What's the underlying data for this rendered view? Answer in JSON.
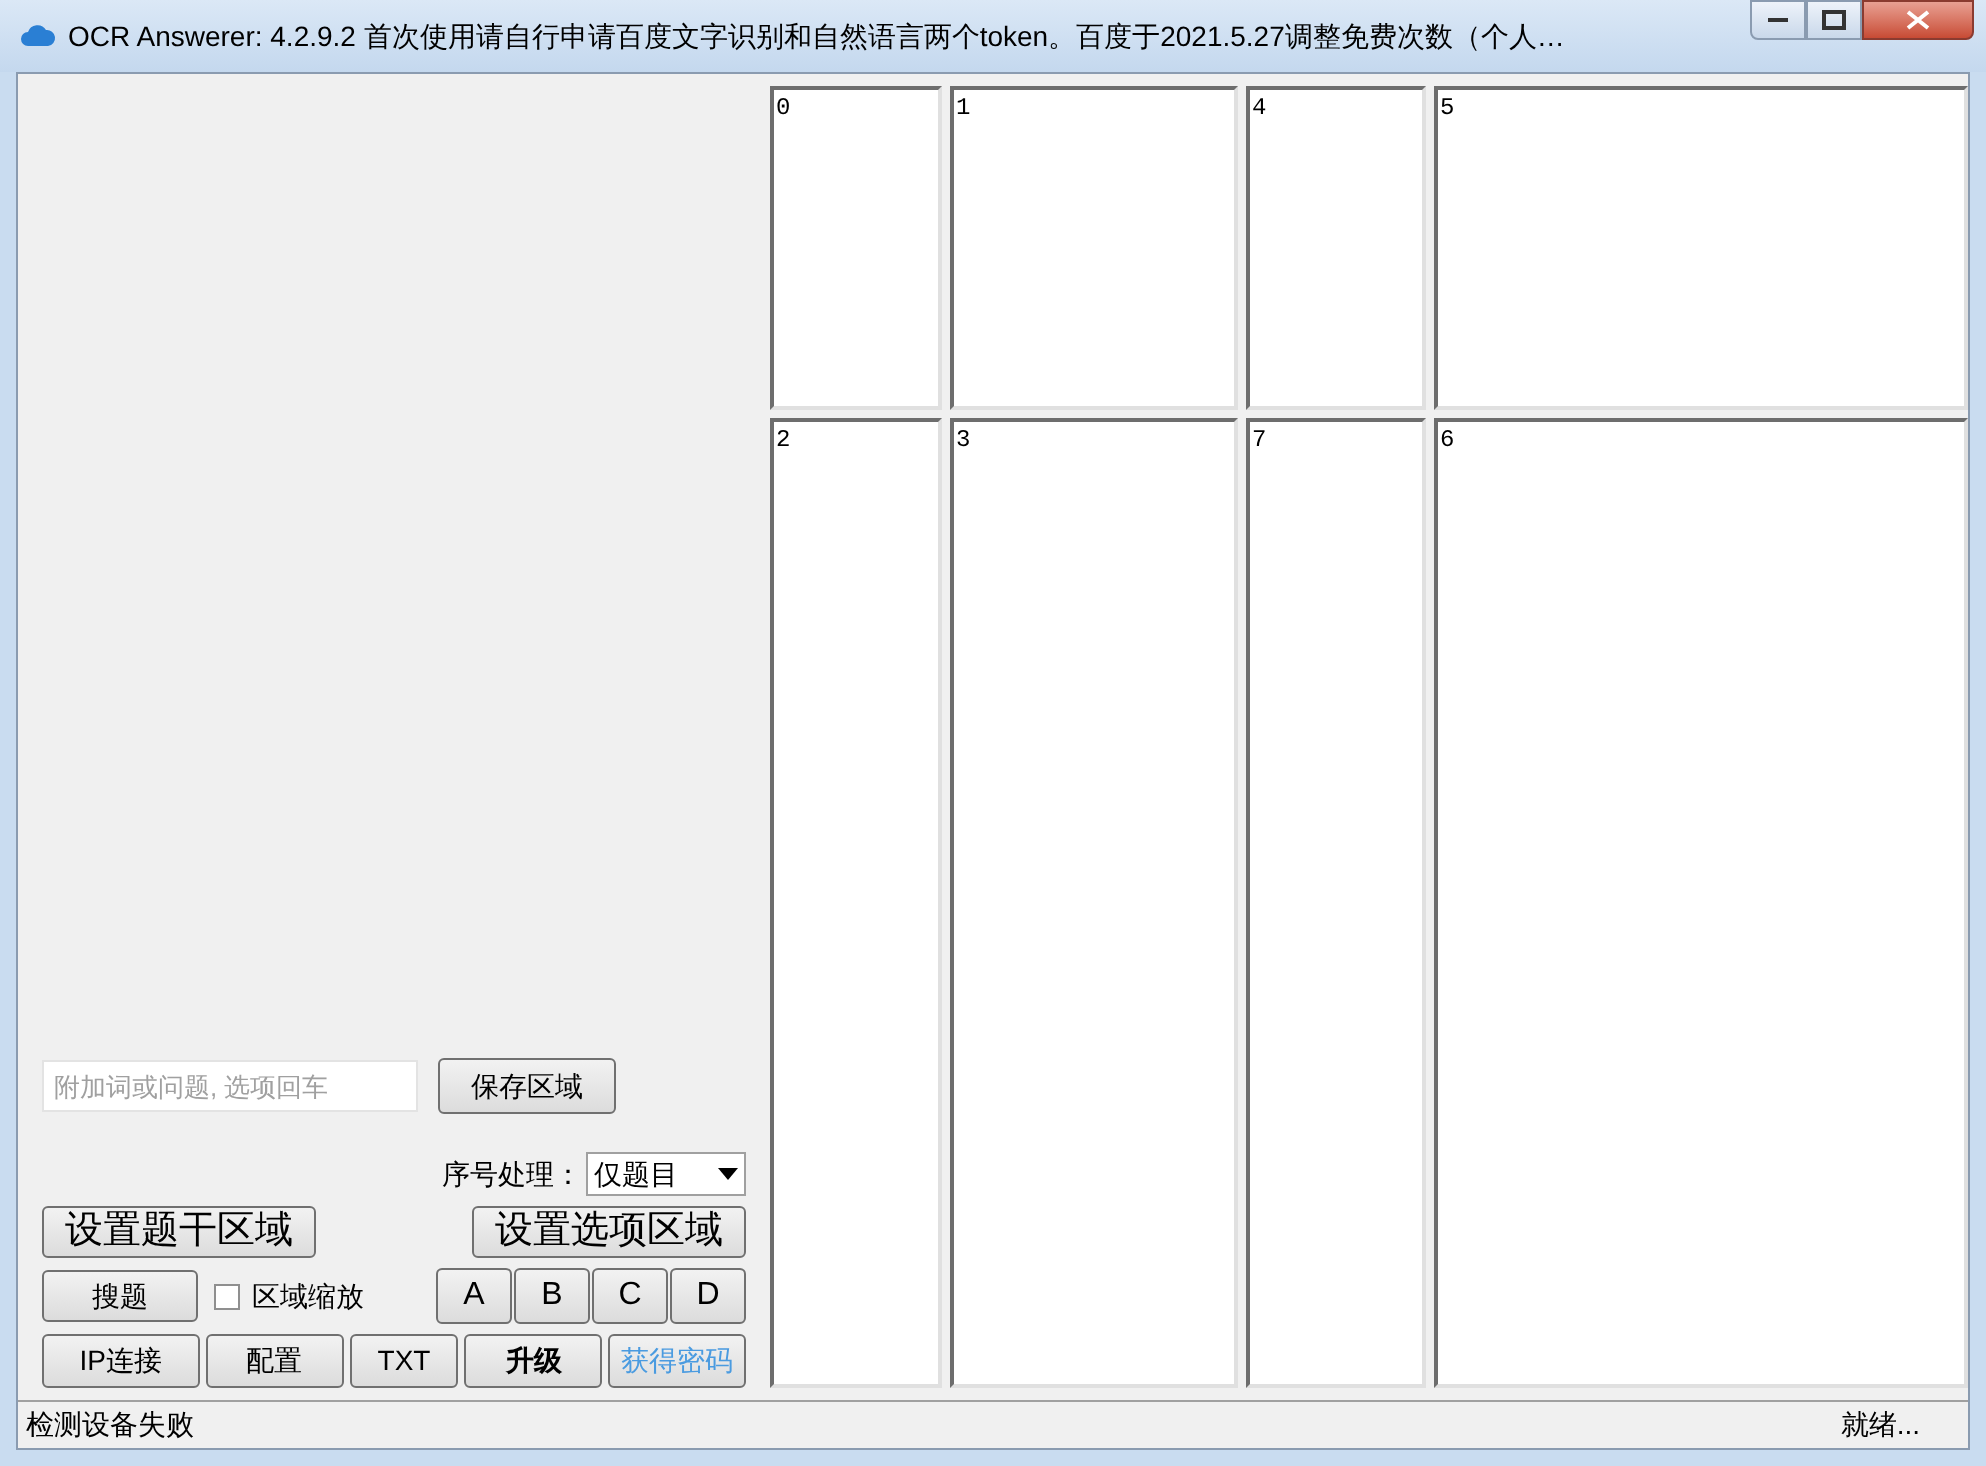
{
  "window": {
    "title": "OCR Answerer: 4.2.9.2 首次使用请自行申请百度文字识别和自然语言两个token。百度于2021.5.27调整免费次数（个人…"
  },
  "panes": [
    [
      "0",
      "1",
      "4",
      "5"
    ],
    [
      "2",
      "3",
      "7",
      "6"
    ]
  ],
  "input": {
    "placeholder": "附加词或问题, 选项回车"
  },
  "save_button": "保存区域",
  "numbering": {
    "label": "序号处理：",
    "value": "仅题目"
  },
  "set_stem_button": "设置题干区域",
  "set_options_button": "设置选项区域",
  "search_button": "搜题",
  "zoom_checkbox": {
    "label": "区域缩放",
    "checked": false
  },
  "option_buttons": [
    "A",
    "B",
    "C",
    "D"
  ],
  "bottom_buttons": [
    {
      "label": "IP连接",
      "kind": "normal"
    },
    {
      "label": "配置",
      "kind": "normal"
    },
    {
      "label": "TXT",
      "kind": "normal"
    },
    {
      "label": "升级",
      "kind": "bold"
    },
    {
      "label": "获得密码",
      "kind": "link"
    }
  ],
  "status_bar": {
    "left": "检测设备失败",
    "right": "就绪..."
  }
}
